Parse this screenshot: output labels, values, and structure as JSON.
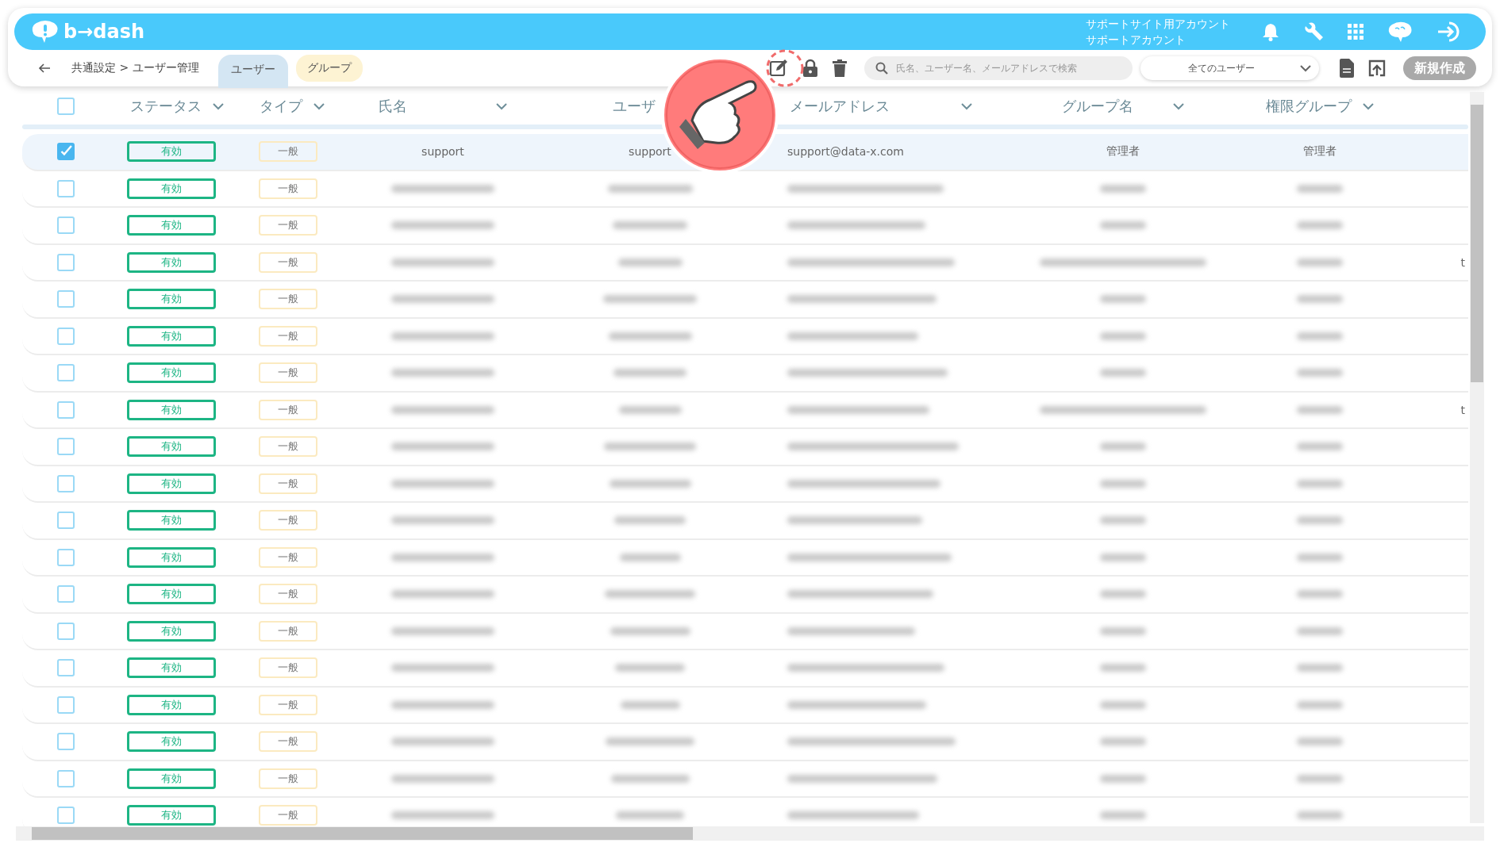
{
  "header": {
    "logo_text": "b→dash",
    "account_lines": [
      "サポートサイト用アカウント",
      "サポートアカウント"
    ]
  },
  "toolbar": {
    "breadcrumb": "共通設定 > ユーザー管理",
    "tabs": [
      {
        "label": "ユーザー",
        "selected": true
      },
      {
        "label": "グループ",
        "selected": false
      }
    ],
    "search": {
      "placeholder": "氏名、ユーザー名、メールアドレスで検索"
    },
    "filter": {
      "value": "全てのユーザー"
    },
    "create_button": {
      "label": "新規作成",
      "disabled": true
    }
  },
  "table": {
    "select_all": {
      "checked": false
    },
    "columns": [
      {
        "label": "ステータス",
        "menu_icon": true
      },
      {
        "label": "タイプ",
        "menu_icon": true
      },
      {
        "label": "氏名",
        "menu_icon": true
      },
      {
        "label": "ユーザ",
        "menu_icon": false
      },
      {
        "label": "メールアドレス",
        "menu_icon": true
      },
      {
        "label": "グループ名",
        "menu_icon": true
      },
      {
        "label": "権限グループ",
        "menu_icon": true
      }
    ],
    "rows": [
      {
        "selected": true,
        "redacted": false,
        "status": "有効",
        "type": "一般",
        "name": "support",
        "username": "support",
        "email": "support@data-x.com",
        "group": "管理者",
        "role_group": "管理者"
      },
      {
        "selected": false,
        "redacted": true,
        "status": "有効",
        "type": "一般"
      },
      {
        "selected": false,
        "redacted": true,
        "status": "有効",
        "type": "一般"
      },
      {
        "selected": false,
        "redacted": true,
        "status": "有効",
        "type": "一般",
        "column_8": "t"
      },
      {
        "selected": false,
        "redacted": true,
        "status": "有効",
        "type": "一般"
      },
      {
        "selected": false,
        "redacted": true,
        "status": "有効",
        "type": "一般"
      },
      {
        "selected": false,
        "redacted": true,
        "status": "有効",
        "type": "一般"
      },
      {
        "selected": false,
        "redacted": true,
        "status": "有効",
        "type": "一般",
        "column_8": "t"
      },
      {
        "selected": false,
        "redacted": true,
        "status": "有効",
        "type": "一般"
      },
      {
        "selected": false,
        "redacted": true,
        "status": "有効",
        "type": "一般"
      },
      {
        "selected": false,
        "redacted": true,
        "status": "有効",
        "type": "一般"
      },
      {
        "selected": false,
        "redacted": true,
        "status": "有効",
        "type": "一般"
      },
      {
        "selected": false,
        "redacted": true,
        "status": "有効",
        "type": "一般"
      },
      {
        "selected": false,
        "redacted": true,
        "status": "有効",
        "type": "一般"
      },
      {
        "selected": false,
        "redacted": true,
        "status": "有効",
        "type": "一般"
      },
      {
        "selected": false,
        "redacted": true,
        "status": "有効",
        "type": "一般"
      },
      {
        "selected": false,
        "redacted": true,
        "status": "有効",
        "type": "一般"
      },
      {
        "selected": false,
        "redacted": true,
        "status": "有効",
        "type": "一般"
      },
      {
        "selected": false,
        "redacted": true,
        "status": "有効",
        "type": "一般"
      }
    ]
  }
}
